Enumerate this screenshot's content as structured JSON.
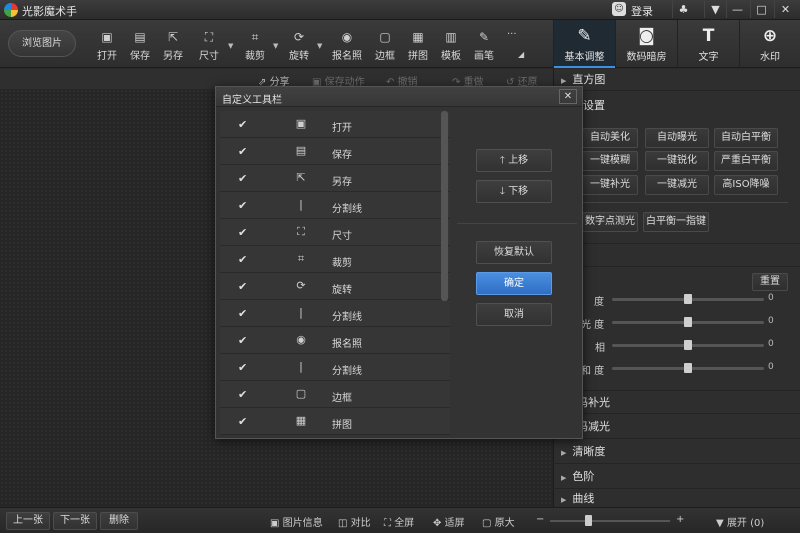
{
  "app": {
    "title": "光影魔术手",
    "login_label": "登录",
    "window_controls": [
      "♣",
      "▼",
      "—",
      "□",
      "✕"
    ]
  },
  "toolbar": {
    "browse_label": "浏览图片",
    "buttons": [
      {
        "label": "打开",
        "icon": "open-icon",
        "glyph": "▣"
      },
      {
        "label": "保存",
        "icon": "save-icon",
        "glyph": "▤"
      },
      {
        "label": "另存",
        "icon": "save-as-icon",
        "glyph": "⇱"
      },
      {
        "label": "尺寸",
        "icon": "resize-icon",
        "glyph": "⛶"
      },
      {
        "label": "裁剪",
        "icon": "crop-icon",
        "glyph": "⌗"
      },
      {
        "label": "旋转",
        "icon": "rotate-icon",
        "glyph": "⟳"
      },
      {
        "label": "报名照",
        "icon": "id-photo-icon",
        "glyph": "◉"
      },
      {
        "label": "边框",
        "icon": "border-icon",
        "glyph": "▢"
      },
      {
        "label": "拼图",
        "icon": "collage-icon",
        "glyph": "▦"
      },
      {
        "label": "模板",
        "icon": "template-icon",
        "glyph": "▥"
      },
      {
        "label": "画笔",
        "icon": "brush-icon",
        "glyph": "✎"
      }
    ],
    "more": "···",
    "right_tabs": [
      {
        "label": "基本调整",
        "icon": "basic-adjust-icon",
        "glyph": "✎"
      },
      {
        "label": "数码暗房",
        "icon": "darkroom-icon",
        "glyph": "◙"
      },
      {
        "label": "文字",
        "icon": "text-icon",
        "glyph": "T"
      },
      {
        "label": "水印",
        "icon": "watermark-icon",
        "glyph": "⊕"
      }
    ]
  },
  "actionbar": {
    "share": "分享",
    "save_action": "保存动作",
    "undo": "撤销",
    "redo": "重做",
    "restore": "还原"
  },
  "right_panel": {
    "histogram": "直方图",
    "one_key": "一键设置",
    "buttons_row1": [
      "自动美化",
      "自动曝光",
      "自动白平衡"
    ],
    "buttons_row2": [
      "一键模糊",
      "一键锐化",
      "严重白平衡"
    ],
    "buttons_row3": [
      "一键补光",
      "一键减光",
      "高ISO降噪"
    ],
    "buttons_row4": [
      "数字点测光",
      "白平衡一指键"
    ],
    "basic": "基本",
    "reset": "重置",
    "sliders": [
      {
        "label": "度",
        "value": 0
      },
      {
        "label": "光 度",
        "value": 0
      },
      {
        "label": "相",
        "value": 0
      },
      {
        "label": "和 度",
        "value": 0
      }
    ],
    "fill_light": "码补光",
    "reduce_light": "码减光",
    "clarity": "清晰度",
    "color_level": "色阶",
    "curve": "曲线"
  },
  "dialog": {
    "title": "自定义工具栏",
    "close": "✕",
    "items": [
      {
        "check": "✔",
        "icon": "open-icon",
        "glyph": "▣",
        "label": "打开"
      },
      {
        "check": "✔",
        "icon": "save-icon",
        "glyph": "▤",
        "label": "保存"
      },
      {
        "check": "✔",
        "icon": "save-as-icon",
        "glyph": "⇱",
        "label": "另存"
      },
      {
        "check": "✔",
        "icon": "separator-icon",
        "glyph": "|",
        "label": "分割线"
      },
      {
        "check": "✔",
        "icon": "resize-icon",
        "glyph": "⛶",
        "label": "尺寸"
      },
      {
        "check": "✔",
        "icon": "crop-icon",
        "glyph": "⌗",
        "label": "裁剪"
      },
      {
        "check": "✔",
        "icon": "rotate-icon",
        "glyph": "⟳",
        "label": "旋转"
      },
      {
        "check": "✔",
        "icon": "separator-icon",
        "glyph": "|",
        "label": "分割线"
      },
      {
        "check": "✔",
        "icon": "id-photo-icon",
        "glyph": "◉",
        "label": "报名照"
      },
      {
        "check": "✔",
        "icon": "separator-icon",
        "glyph": "|",
        "label": "分割线"
      },
      {
        "check": "✔",
        "icon": "border-icon",
        "glyph": "▢",
        "label": "边框"
      },
      {
        "check": "✔",
        "icon": "collage-icon",
        "glyph": "▦",
        "label": "拼图"
      }
    ],
    "move_up": "上移",
    "move_down": "下移",
    "restore_default": "恢复默认",
    "ok": "确定",
    "cancel": "取消"
  },
  "bottombar": {
    "prev": "上一张",
    "next": "下一张",
    "delete": "删除",
    "image_info": "图片信息",
    "compare": "对比",
    "fullscreen": "全屏",
    "fit": "适屏",
    "original": "原大",
    "expand": "展开",
    "expand_count": "(0)",
    "zoom_minus": "−",
    "zoom_plus": "+"
  },
  "colors": {
    "accent": "#3d8fe0",
    "ok_button": "#2f6ec4"
  }
}
